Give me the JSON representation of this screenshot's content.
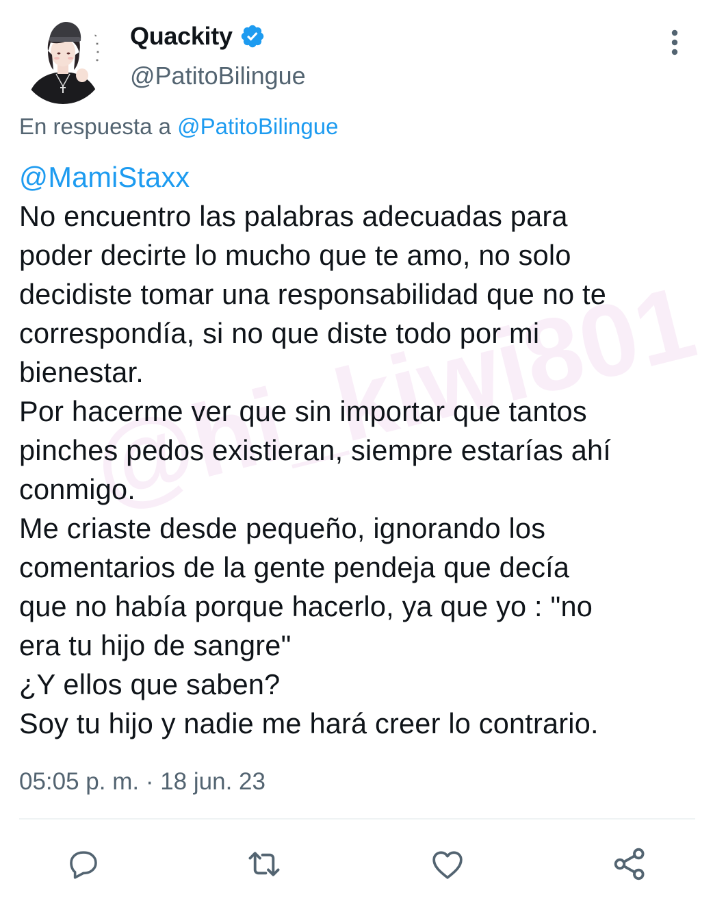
{
  "tweet": {
    "author": {
      "display_name": "Quackity",
      "handle": "@PatitoBilingue",
      "verified": true,
      "avatar_icon": "avatar-illustration-icon"
    },
    "reply_to": {
      "prefix": "En respuesta a ",
      "mention": "@PatitoBilingue"
    },
    "mention": "@MamiStaxx",
    "body_lines": [
      "No encuentro las palabras adecuadas para",
      "poder decirte lo mucho que te amo, no solo",
      "decidiste tomar una responsabilidad que no te",
      "correspondía, si no que diste todo por mi",
      "bienestar.",
      "Por hacerme ver que sin importar que tantos",
      "pinches pedos existieran, siempre estarías ahí",
      "conmigo.",
      "Me criaste desde pequeño, ignorando los",
      "comentarios de la gente pendeja que decía",
      "que no había porque hacerlo, ya que yo : \"no",
      "era tu hijo de sangre\"",
      "¿Y ellos que saben?",
      "Soy tu hijo y nadie me hará creer lo contrario."
    ],
    "timestamp": "05:05 p. m. · 18 jun. 23"
  },
  "watermark": "@hi_kiwi801",
  "actions": {
    "icons": [
      "reply-icon",
      "retweet-icon",
      "like-icon",
      "share-icon"
    ]
  },
  "colors": {
    "text": "#0f1419",
    "secondary": "#536471",
    "accent": "#1d9bf0",
    "divider": "#eff3f4"
  }
}
